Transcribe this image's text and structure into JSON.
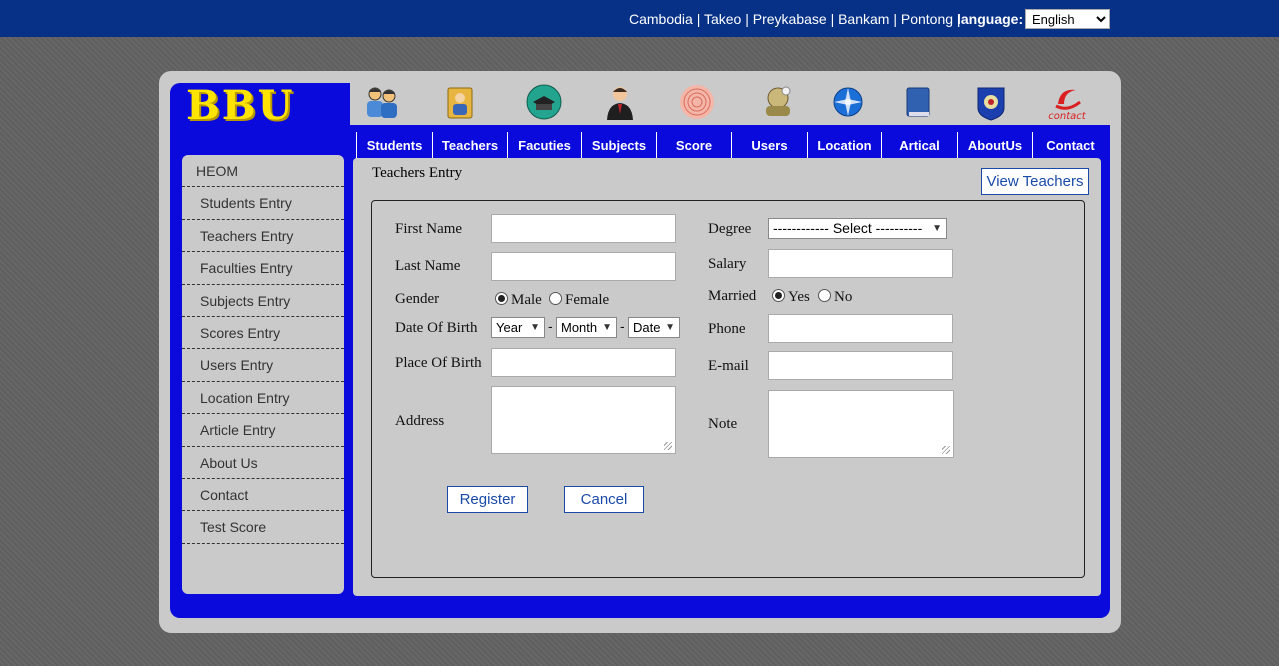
{
  "topbar": {
    "places": "Cambodia | Takeo | Preykabase | Bankam | Pontong |",
    "language_label": "language:",
    "language_value": "English"
  },
  "logo": {
    "text": "BBU"
  },
  "header_icons": [
    {
      "name": "students-icon"
    },
    {
      "name": "teachers-icon"
    },
    {
      "name": "faculties-icon"
    },
    {
      "name": "subjects-icon"
    },
    {
      "name": "score-icon"
    },
    {
      "name": "users-icon"
    },
    {
      "name": "location-icon"
    },
    {
      "name": "artical-icon"
    },
    {
      "name": "aboutus-icon"
    },
    {
      "name": "contact-icon",
      "text": "contact"
    }
  ],
  "nav": {
    "items": [
      "Students",
      "Teachers",
      "Facuties",
      "Subjects",
      "Score",
      "Users",
      "Location",
      "Artical",
      "AboutUs",
      "Contact"
    ]
  },
  "sidebar": {
    "heading": "HEOM",
    "items": [
      "Students Entry",
      "Teachers Entry",
      "Faculties Entry",
      "Subjects Entry",
      "Scores Entry",
      "Users Entry",
      "Location Entry",
      "Article Entry",
      "About Us",
      "Contact",
      "Test Score"
    ]
  },
  "page": {
    "title": "Teachers Entry",
    "view_button": "View Teachers"
  },
  "form": {
    "first_name": "First Name",
    "last_name": "Last Name",
    "gender": "Gender",
    "gender_male": "Male",
    "gender_female": "Female",
    "dob": "Date Of Birth",
    "dob_year": "Year",
    "dob_month": "Month",
    "dob_date": "Date",
    "dob_sep": "-",
    "place_of_birth": "Place Of Birth",
    "address": "Address",
    "degree": "Degree",
    "degree_select": "------------ Select ----------",
    "salary": "Salary",
    "married": "Married",
    "married_yes": "Yes",
    "married_no": "No",
    "phone": "Phone",
    "email": "E-mail",
    "note": "Note",
    "register": "Register",
    "cancel": "Cancel"
  },
  "colors": {
    "topbar": "#063187",
    "frame_blue": "#0a0adc",
    "panel_gray": "#cacaca",
    "logo_yellow": "#ffe400",
    "link_blue": "#1a4aa8"
  }
}
